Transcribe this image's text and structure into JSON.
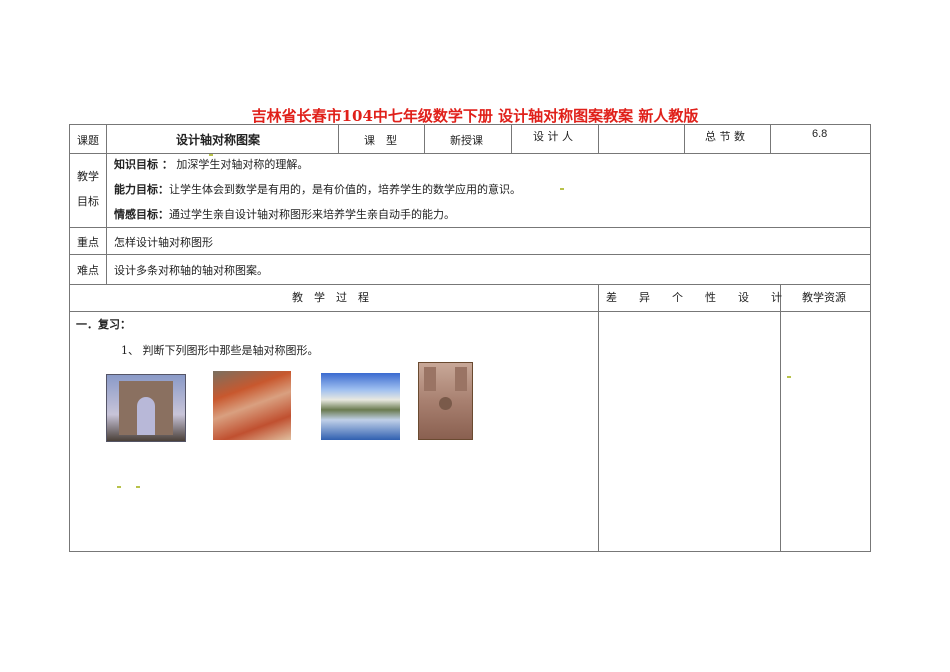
{
  "title": "吉林省长春市104中七年级数学下册 设计轴对称图案教案 新人教版",
  "header": {
    "topic_label": "课题",
    "topic": "设计轴对称图案",
    "type_label": "课　型",
    "type": "新授课",
    "designer_label": "设 计 人",
    "designer": "",
    "sessions_label": "总 节 数",
    "sessions": "6.8"
  },
  "objectives": {
    "label1": "教学",
    "label2": "目标",
    "items": [
      {
        "label": "知识目标 ：",
        "text": "加深学生对轴对称的理解。"
      },
      {
        "label": "能力目标：",
        "text": "让学生体会到数学是有用的，是有价值的，培养学生的数学应用的意识。"
      },
      {
        "label": "情感目标：",
        "text": "通过学生亲自设计轴对称图形来培养学生亲自动手的能力。"
      }
    ]
  },
  "key": {
    "label": "重点",
    "text": "怎样设计轴对称图形"
  },
  "difficulty": {
    "label": "难点",
    "text": "设计多条对称轴的轴对称图案。"
  },
  "process": {
    "col1": "教　学　过　程",
    "col2": "差　　异　　个　　性　　设　　计",
    "col3": "教学资源",
    "section": "一．复习：",
    "question": "1、 判断下列图形中那些是轴对称图形。"
  }
}
